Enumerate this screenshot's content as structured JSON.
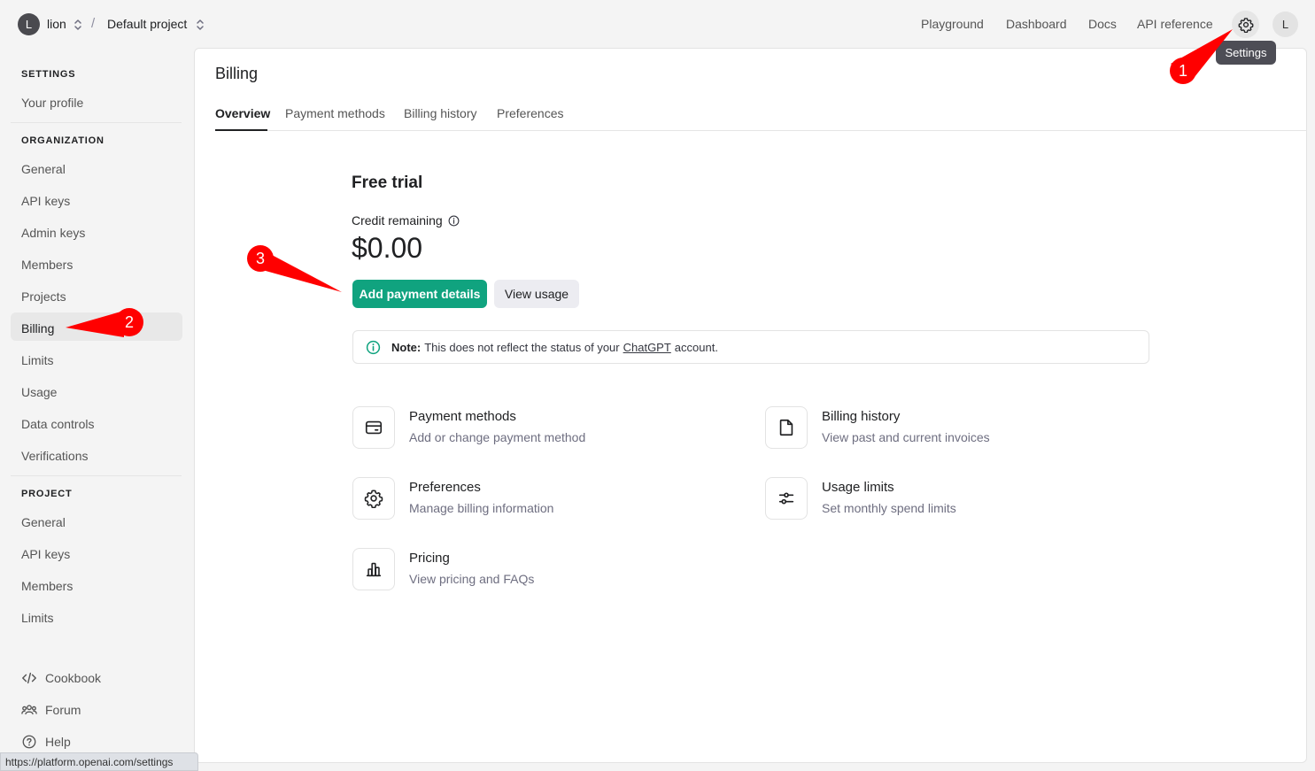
{
  "topbar": {
    "org_initial": "L",
    "org_name": "lion",
    "separator": "/",
    "project_name": "Default project",
    "nav": [
      "Playground",
      "Dashboard",
      "Docs",
      "API reference"
    ],
    "user_initial": "L",
    "tooltip": "Settings"
  },
  "sidebar": {
    "settings_heading": "SETTINGS",
    "settings_items": [
      "Your profile"
    ],
    "organization_heading": "ORGANIZATION",
    "organization_items": [
      "General",
      "API keys",
      "Admin keys",
      "Members",
      "Projects",
      "Billing",
      "Limits",
      "Usage",
      "Data controls",
      "Verifications"
    ],
    "active_item": "Billing",
    "project_heading": "PROJECT",
    "project_items": [
      "General",
      "API keys",
      "Members",
      "Limits"
    ],
    "footer": [
      "Cookbook",
      "Forum",
      "Help"
    ]
  },
  "main": {
    "title": "Billing",
    "tabs": [
      "Overview",
      "Payment methods",
      "Billing history",
      "Preferences"
    ],
    "active_tab": "Overview",
    "plan": "Free trial",
    "credit_label": "Credit remaining",
    "credit_amount": "$0.00",
    "primary_button": "Add payment details",
    "secondary_button": "View usage",
    "note": {
      "bold": "Note:",
      "before": "This does not reflect the status of your",
      "link": "ChatGPT",
      "after": "account."
    },
    "cards": [
      {
        "icon": "credit-card-icon",
        "title": "Payment methods",
        "subtitle": "Add or change payment method"
      },
      {
        "icon": "document-icon",
        "title": "Billing history",
        "subtitle": "View past and current invoices"
      },
      {
        "icon": "gear-icon",
        "title": "Preferences",
        "subtitle": "Manage billing information"
      },
      {
        "icon": "sliders-icon",
        "title": "Usage limits",
        "subtitle": "Set monthly spend limits"
      },
      {
        "icon": "bar-chart-icon",
        "title": "Pricing",
        "subtitle": "View pricing and FAQs"
      }
    ]
  },
  "annotations": [
    "1",
    "2",
    "3"
  ],
  "colors": {
    "accent": "#10a37f",
    "annotation": "#ff0000"
  },
  "statusbar": "https://platform.openai.com/settings"
}
